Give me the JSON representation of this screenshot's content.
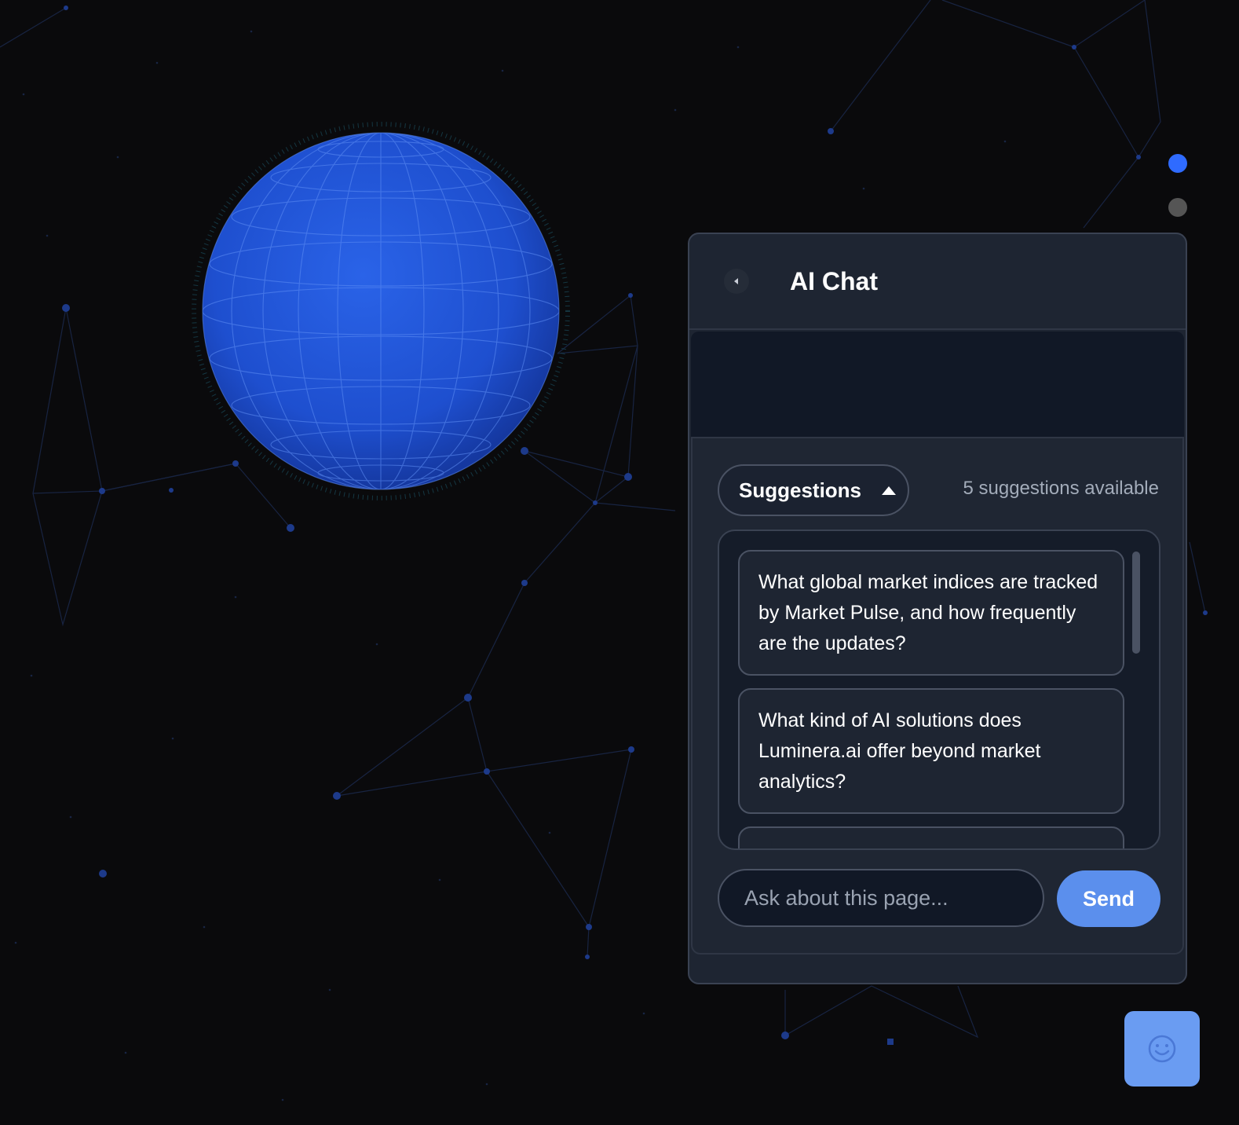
{
  "nav_dots": [
    {
      "name": "section-1",
      "active": true
    },
    {
      "name": "section-2",
      "active": false
    }
  ],
  "chat": {
    "title": "AI Chat",
    "back_icon": "chevron-left-icon",
    "suggestions": {
      "toggle_label": "Suggestions",
      "toggle_icon": "caret-up-icon",
      "count_text": "5 suggestions available",
      "items": [
        "What global market indices are tracked by Market Pulse, and how frequently are the updates?",
        "What kind of AI solutions does Luminera.ai offer beyond market analytics?"
      ]
    },
    "input": {
      "placeholder": "Ask about this page...",
      "value": ""
    },
    "send_label": "Send"
  },
  "fab": {
    "icon": "smiley-face-icon"
  },
  "colors": {
    "background": "#0a0a0c",
    "accent": "#2f6bff",
    "send_button": "#5b8fed",
    "panel": "#1e2532"
  }
}
